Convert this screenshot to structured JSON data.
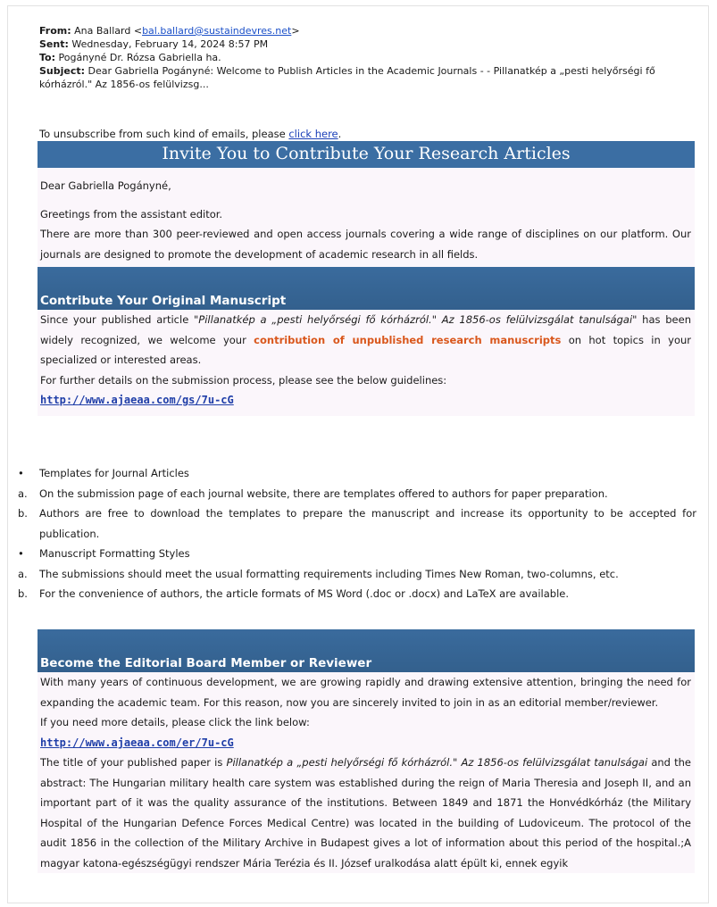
{
  "header": {
    "from_label": "From:",
    "from_name": "Ana Ballard <",
    "from_email": "bal.ballard@sustaindevres.net",
    "from_close": ">",
    "sent_label": "Sent:",
    "sent_value": "Wednesday, February 14, 2024 8:57 PM",
    "to_label": "To:",
    "to_value": "Pogányné Dr. Rózsa Gabriella ha.",
    "subject_label": "Subject:",
    "subject_value": "Dear Gabriella Pogányné: Welcome to Publish Articles in the Academic Journals - - Pillanatkép a „pesti helyőrségi fő kórházról.\" Az 1856-os felülvizsg..."
  },
  "unsubscribe": {
    "text": "To unsubscribe from such kind of emails, please ",
    "link": "click here",
    "end": "."
  },
  "banner": {
    "title": "Invite You to Contribute Your Research Articles"
  },
  "intro": {
    "salutation": "Dear Gabriella Pogányné,",
    "greeting": "Greetings from the assistant editor.",
    "para1": "There are more than 300 peer-reviewed and open access journals covering a wide range of disciplines on our platform. Our journals are designed to promote the development of academic research in all fields."
  },
  "section1": {
    "title": "Contribute Your Original Manuscript",
    "text_a": "Since your published article ",
    "article_title": "\"Pillanatkép a „pesti helyőrségi fő kórházról.\" Az 1856-os felülvizsgálat tanulságai\"",
    "text_b": " has been widely recognized, we welcome your ",
    "highlight": "contribution of unpublished research manuscripts",
    "text_c": " on hot topics in your specialized or interested areas.",
    "further": "For further details on the submission process, please see the below guidelines:",
    "link": "http://www.ajaeaa.com/gs/7u-cG"
  },
  "guidelines": [
    {
      "marker": "•",
      "text": "Templates for Journal Articles"
    },
    {
      "marker": "a.",
      "text": "On the submission page of each journal website, there are templates offered to authors for paper preparation."
    },
    {
      "marker": "b.",
      "text": "Authors are free to download the templates to prepare the manuscript and increase its opportunity to be accepted for publication."
    },
    {
      "marker": "•",
      "text": "Manuscript Formatting Styles"
    },
    {
      "marker": "a.",
      "text": "The submissions should meet the usual formatting requirements including Times New Roman, two-columns, etc."
    },
    {
      "marker": "b.",
      "text": "For the convenience of authors, the article formats of MS Word (.doc or .docx) and LaTeX are available."
    }
  ],
  "section2": {
    "title": "Become the Editorial Board Member or Reviewer",
    "para": "With many years of continuous development, we are growing rapidly and drawing extensive attention, bringing the need for expanding the academic team. For this reason, now you are sincerely invited to join in as an editorial member/reviewer.",
    "more": "If you need more details, please click the link below:",
    "link": "http://www.ajaeaa.com/er/7u-cG",
    "title_intro": "The title of your published paper is ",
    "paper_title": "Pillanatkép a „pesti helyőrségi fő kórházról.\" Az 1856-os felülvizsgálat tanulságai",
    "abstract": " and the abstract: The Hungarian military health care system was established during the reign of Maria Theresia and Joseph II, and an important part of it was the quality assurance of the institutions. Between 1849 and 1871 the Honvédkórház (the Military Hospital of the Hungarian Defence Forces Medical Centre) was located in the building of Ludoviceum. The protocol of the audit 1856 in the collection of the Military Archive in Budapest gives a lot of information about this period of the hospital.;A magyar katona-egészségügyi rendszer Mária Terézia és II. József uralkodása alatt épült ki, ennek egyik"
  },
  "colors": {
    "banner": "#3b6ea3",
    "section_bar": "#3a6b9d",
    "highlight": "#d9571c",
    "link": "#1f3ea8",
    "content_bg": "#fbf6fb"
  }
}
